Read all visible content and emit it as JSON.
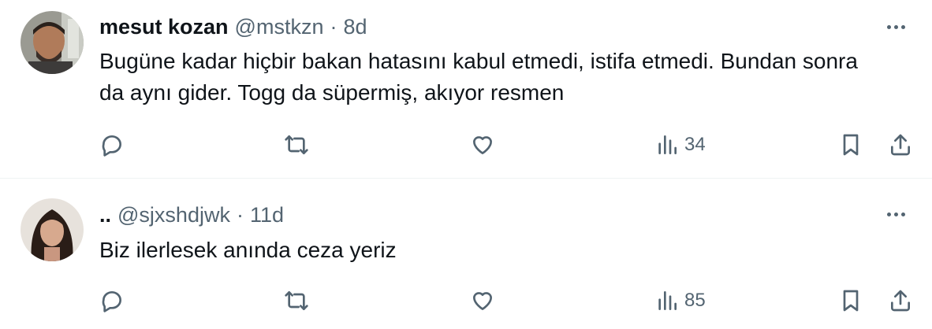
{
  "tweets": [
    {
      "name": "mesut kozan",
      "handle": "@mstkzn",
      "separator": "·",
      "time": "8d",
      "text": "Bugüne kadar hiçbir bakan hatasını kabul etmedi, istifa etmedi. Bundan sonra da aynı gider. Togg da süpermiş, akıyor resmen",
      "views": "34",
      "icons": [
        "reply-icon",
        "retweet-icon",
        "like-icon",
        "views-icon",
        "bookmark-icon",
        "share-icon",
        "more-icon"
      ]
    },
    {
      "name": "..",
      "handle": "@sjxshdjwk",
      "separator": "·",
      "time": "11d",
      "text": "Biz ilerlesek anında ceza yeriz",
      "views": "85",
      "icons": [
        "reply-icon",
        "retweet-icon",
        "like-icon",
        "views-icon",
        "bookmark-icon",
        "share-icon",
        "more-icon"
      ]
    }
  ],
  "colors": {
    "text_primary": "#0f1419",
    "text_secondary": "#536471",
    "divider": "#eff3f4"
  }
}
